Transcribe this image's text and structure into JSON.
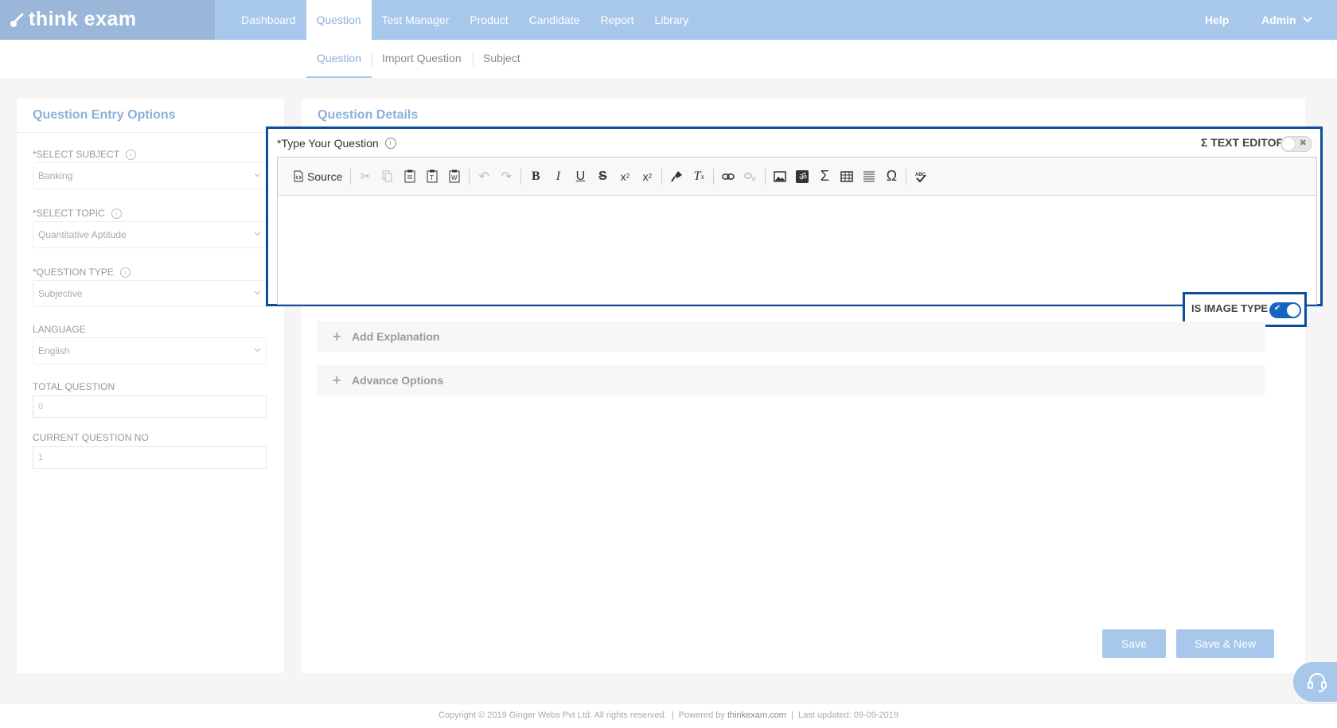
{
  "app": {
    "name": "think exam"
  },
  "nav": {
    "items": [
      {
        "label": "Dashboard",
        "active": false
      },
      {
        "label": "Question",
        "active": true
      },
      {
        "label": "Test Manager",
        "active": false
      },
      {
        "label": "Product",
        "active": false
      },
      {
        "label": "Candidate",
        "active": false
      },
      {
        "label": "Report",
        "active": false
      },
      {
        "label": "Library",
        "active": false
      }
    ],
    "help": "Help",
    "user": "Admin"
  },
  "subnav": {
    "tabs": [
      {
        "label": "Question",
        "active": true
      },
      {
        "label": "Import Question",
        "active": false
      },
      {
        "label": "Subject",
        "active": false
      }
    ]
  },
  "left_panel": {
    "title": "Question Entry Options",
    "select_subject": {
      "label": "*SELECT SUBJECT",
      "value": "Banking"
    },
    "select_topic": {
      "label": "*SELECT TOPIC",
      "value": "Quantitative Aptitude"
    },
    "question_type": {
      "label": "*QUESTION TYPE",
      "value": "Subjective"
    },
    "language": {
      "label": "LANGUAGE",
      "value": "English"
    },
    "total_question": {
      "label": "TOTAL QUESTION",
      "value": "0"
    },
    "current_question_no": {
      "label": "CURRENT QUESTION NO",
      "value": "1"
    }
  },
  "main_panel": {
    "title": "Question Details",
    "question_label": "*Type Your Question",
    "text_editor_label": "Σ TEXT EDITOR",
    "text_editor_enabled": false,
    "is_image_type_label": "IS IMAGE TYPE",
    "is_image_type_enabled": true,
    "toolbar": {
      "source_label": "Source"
    },
    "add_explanation": "Add Explanation",
    "advance_options": "Advance Options",
    "save_label": "Save",
    "save_new_label": "Save & New"
  },
  "footer": {
    "copyright": "Copyright © 2019 Ginger Webs Pvt Ltd. All rights reserved.",
    "sep1": "|",
    "powered_by": "Powered by",
    "brand": "thinkexam.com",
    "sep2": "|",
    "last_updated": "Last updated: 09-09-2019"
  },
  "colors": {
    "topbar": "#a7c8eb",
    "accent": "#8ab1dc",
    "highlight_border": "#0d4f9c",
    "toggle_on": "#1565c0"
  }
}
